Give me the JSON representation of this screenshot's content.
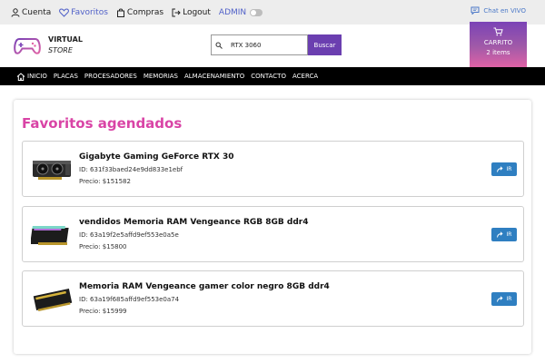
{
  "topbar": {
    "account_label": "Cuenta",
    "favorites_label": "Favoritos",
    "purchases_label": "Compras",
    "logout_label": "Logout",
    "admin_label": "ADMIN",
    "chat_label": "Chat en VIVO"
  },
  "header": {
    "brand_line1": "VIRTUAL",
    "brand_line2": "STORE",
    "search_value": "RTX 3060",
    "search_button": "Buscar",
    "cart_label": "CARRITO",
    "cart_count": "2 items"
  },
  "nav": {
    "items": [
      "INICIO",
      "PLACAS",
      "PROCESADORES",
      "MEMORIAS",
      "ALMACENAMIENTO",
      "CONTACTO",
      "ACERCA"
    ]
  },
  "main": {
    "title": "Favoritos agendados",
    "items": [
      {
        "title": "Gigabyte Gaming GeForce RTX 30",
        "id": "ID: 631f33baed24e9dd833e1ebf",
        "price": "Precio: $151582",
        "button": "IR",
        "icon": "graphics-card-image"
      },
      {
        "title": "vendidos Memoria RAM Vengeance RGB 8GB ddr4",
        "id": "ID: 63a19f2e5affd9ef553e0a5e",
        "price": "Precio: $15800",
        "button": "IR",
        "icon": "ram-stick-image"
      },
      {
        "title": "Memoria RAM Vengeance gamer color negro 8GB ddr4",
        "id": "ID: 63a19f685affd9ef553e0a74",
        "price": "Precio: $15999",
        "button": "IR",
        "icon": "ram-stick-image"
      }
    ]
  },
  "colors": {
    "accent_purple": "#6b3fb0",
    "title_pink": "#d944a6",
    "button_blue": "#2f7fc1",
    "link_blue": "#5060c8"
  }
}
